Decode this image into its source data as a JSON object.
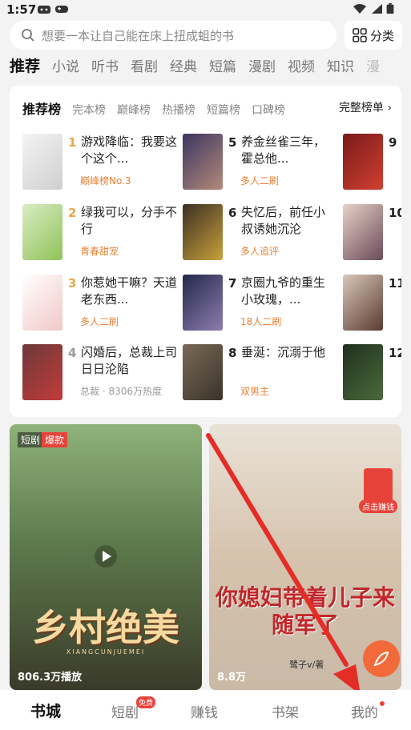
{
  "status_bar": {
    "time": "1:57"
  },
  "search": {
    "placeholder": "想要一本让自己能在床上扭成蛆的书",
    "category_label": "分类"
  },
  "top_tabs": [
    "推荐",
    "小说",
    "听书",
    "看剧",
    "经典",
    "短篇",
    "漫剧",
    "视频",
    "知识",
    "漫"
  ],
  "rank": {
    "tabs": [
      "推荐榜",
      "完本榜",
      "巅峰榜",
      "热播榜",
      "短篇榜",
      "口碑榜"
    ],
    "full_list": "完整榜单",
    "books": [
      {
        "num": "1",
        "title": "游戏降临：我要这个这个...",
        "tag": "巅峰榜No.3"
      },
      {
        "num": "2",
        "title": "绿我可以，分手不行",
        "tag": "青春甜宠"
      },
      {
        "num": "3",
        "title": "你惹她干嘛？天道老东西...",
        "tag": "多人二刷"
      },
      {
        "num": "4",
        "title": "闪婚后，总裁上司日日沦陷",
        "tag": "总裁 · 8306万热度"
      },
      {
        "num": "5",
        "title": "养金丝雀三年，霍总他...",
        "tag": "多人二刷"
      },
      {
        "num": "6",
        "title": "失忆后，前任小叔诱她沉沦",
        "tag": "多人追评"
      },
      {
        "num": "7",
        "title": "京圈九爷的重生小玫瑰，...",
        "tag": "18人二刷"
      },
      {
        "num": "8",
        "title": "垂涎：沉溺于他",
        "tag": "双男主"
      },
      {
        "num": "9",
        "title": "",
        "tag": ""
      },
      {
        "num": "10",
        "title": "",
        "tag": ""
      },
      {
        "num": "11",
        "title": "",
        "tag": ""
      },
      {
        "num": "12",
        "title": "",
        "tag": ""
      }
    ]
  },
  "videos": [
    {
      "badge_type": "短剧",
      "badge_hot": "爆款",
      "title": "乡村绝美",
      "subtitle": "XIANGCUNJUEMEI",
      "plays": "806.3万播放"
    },
    {
      "badge_type": "",
      "badge_hot": "",
      "title": "你媳妇带着儿子来随军了",
      "author": "鹭子v/著",
      "plays": "8.8万",
      "promo": "点击赚钱"
    }
  ],
  "bottom_nav": [
    "书城",
    "短剧",
    "赚钱",
    "书架",
    "我的"
  ],
  "free_badge": "免费"
}
